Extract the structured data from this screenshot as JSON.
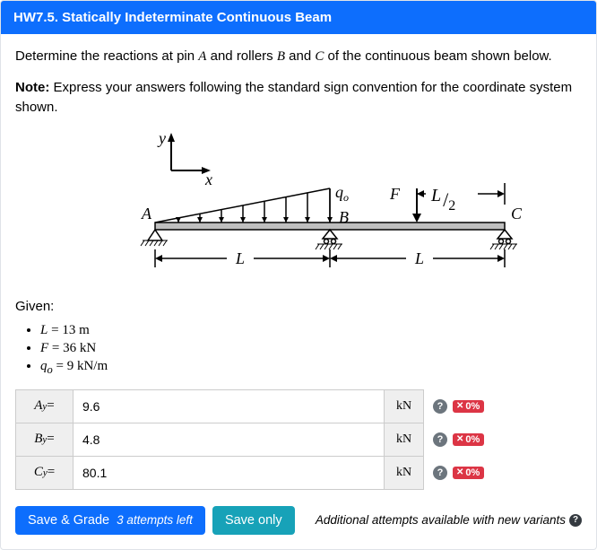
{
  "header": {
    "title": "HW7.5. Statically Indeterminate Continuous Beam"
  },
  "prompt": {
    "text_before_A": "Determine the reactions at pin ",
    "A": "A",
    "text_mid1": " and rollers ",
    "B": "B",
    "text_mid2": " and ",
    "C": "C",
    "text_after": " of the continuous beam shown below."
  },
  "note": {
    "label": "Note:",
    "text": " Express your answers following the standard sign convention for the coordinate system shown."
  },
  "figure": {
    "y": "y",
    "x": "x",
    "A": "A",
    "B": "B",
    "C": "C",
    "q0": "q",
    "q0sub": "o",
    "F": "F",
    "half": "L",
    "half2": "2",
    "L1": "L",
    "L2": "L"
  },
  "given": {
    "heading": "Given:",
    "items": [
      {
        "lhs_var": "L",
        "eq": " = ",
        "val": "13",
        "unit": " m"
      },
      {
        "lhs_var": "F",
        "eq": " = ",
        "val": "36",
        "unit": " kN"
      },
      {
        "lhs_var": "q",
        "lhs_sub": "o",
        "eq": " = ",
        "val": "9",
        "unit": " kN/m"
      }
    ]
  },
  "answers": [
    {
      "label_var": "A",
      "label_sub": "y",
      "eq": " =",
      "value": "9.6",
      "unit": "kN",
      "score": "0%"
    },
    {
      "label_var": "B",
      "label_sub": "y",
      "eq": " =",
      "value": "4.8",
      "unit": "kN",
      "score": "0%"
    },
    {
      "label_var": "C",
      "label_sub": "y",
      "eq": " =",
      "value": "80.1",
      "unit": "kN",
      "score": "0%"
    }
  ],
  "buttons": {
    "save_grade": "Save & Grade",
    "attempts": "3 attempts left",
    "save_only": "Save only",
    "extra": "Additional attempts available with new variants"
  },
  "glyphs": {
    "help": "?",
    "x": "✕",
    "info": "?"
  }
}
